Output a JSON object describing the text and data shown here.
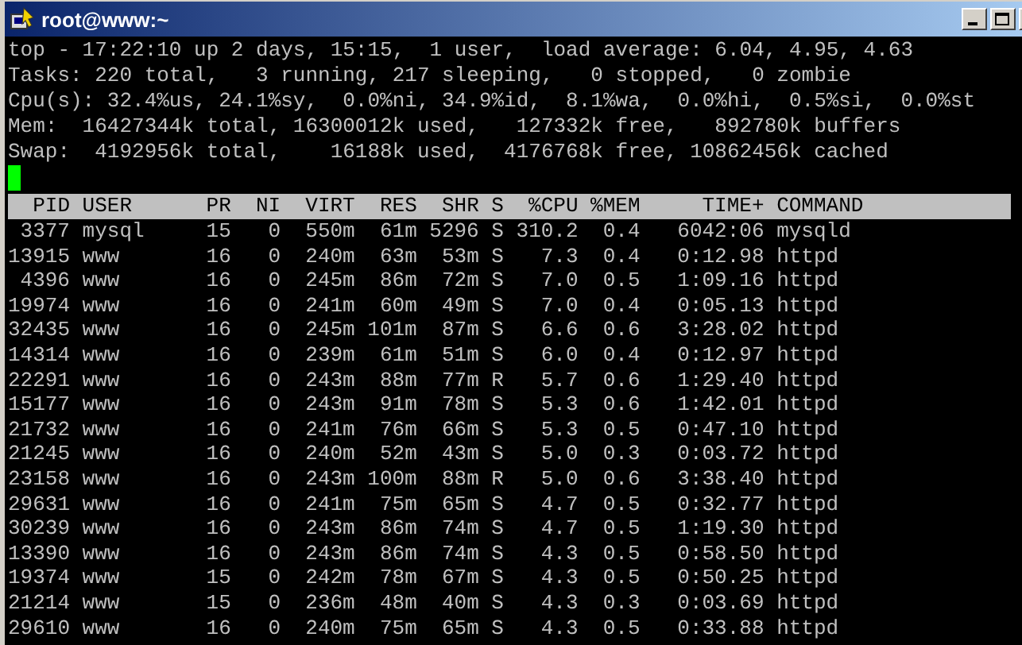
{
  "window": {
    "title": "root@www:~"
  },
  "summary": [
    "top - 17:22:10 up 2 days, 15:15,  1 user,  load average: 6.04, 4.95, 4.63",
    "Tasks: 220 total,   3 running, 217 sleeping,   0 stopped,   0 zombie",
    "Cpu(s): 32.4%us, 24.1%sy,  0.0%ni, 34.9%id,  8.1%wa,  0.0%hi,  0.5%si,  0.0%st",
    "Mem:  16427344k total, 16300012k used,   127332k free,   892780k buffers",
    "Swap:  4192956k total,    16188k used,  4176768k free, 10862456k cached"
  ],
  "table": {
    "columns": [
      "PID",
      "USER",
      "PR",
      "NI",
      "VIRT",
      "RES",
      "SHR",
      "S",
      "%CPU",
      "%MEM",
      "TIME+",
      "COMMAND"
    ],
    "rows": [
      [
        "3377",
        "mysql",
        "15",
        "0",
        "550m",
        "61m",
        "5296",
        "S",
        "310.2",
        "0.4",
        "6042:06",
        "mysqld"
      ],
      [
        "13915",
        "www",
        "16",
        "0",
        "240m",
        "63m",
        "53m",
        "S",
        "7.3",
        "0.4",
        "0:12.98",
        "httpd"
      ],
      [
        "4396",
        "www",
        "16",
        "0",
        "245m",
        "86m",
        "72m",
        "S",
        "7.0",
        "0.5",
        "1:09.16",
        "httpd"
      ],
      [
        "19974",
        "www",
        "16",
        "0",
        "241m",
        "60m",
        "49m",
        "S",
        "7.0",
        "0.4",
        "0:05.13",
        "httpd"
      ],
      [
        "32435",
        "www",
        "16",
        "0",
        "245m",
        "101m",
        "87m",
        "S",
        "6.6",
        "0.6",
        "3:28.02",
        "httpd"
      ],
      [
        "14314",
        "www",
        "16",
        "0",
        "239m",
        "61m",
        "51m",
        "S",
        "6.0",
        "0.4",
        "0:12.97",
        "httpd"
      ],
      [
        "22291",
        "www",
        "16",
        "0",
        "243m",
        "88m",
        "77m",
        "R",
        "5.7",
        "0.6",
        "1:29.40",
        "httpd"
      ],
      [
        "15177",
        "www",
        "16",
        "0",
        "243m",
        "91m",
        "78m",
        "S",
        "5.3",
        "0.6",
        "1:42.01",
        "httpd"
      ],
      [
        "21732",
        "www",
        "16",
        "0",
        "241m",
        "76m",
        "66m",
        "S",
        "5.3",
        "0.5",
        "0:47.10",
        "httpd"
      ],
      [
        "21245",
        "www",
        "16",
        "0",
        "240m",
        "52m",
        "43m",
        "S",
        "5.0",
        "0.3",
        "0:03.72",
        "httpd"
      ],
      [
        "23158",
        "www",
        "16",
        "0",
        "243m",
        "100m",
        "88m",
        "R",
        "5.0",
        "0.6",
        "3:38.40",
        "httpd"
      ],
      [
        "29631",
        "www",
        "16",
        "0",
        "241m",
        "75m",
        "65m",
        "S",
        "4.7",
        "0.5",
        "0:32.77",
        "httpd"
      ],
      [
        "30239",
        "www",
        "16",
        "0",
        "243m",
        "86m",
        "74m",
        "S",
        "4.7",
        "0.5",
        "1:19.30",
        "httpd"
      ],
      [
        "13390",
        "www",
        "16",
        "0",
        "243m",
        "86m",
        "74m",
        "S",
        "4.3",
        "0.5",
        "0:58.50",
        "httpd"
      ],
      [
        "19374",
        "www",
        "15",
        "0",
        "242m",
        "78m",
        "67m",
        "S",
        "4.3",
        "0.5",
        "0:50.25",
        "httpd"
      ],
      [
        "21214",
        "www",
        "15",
        "0",
        "236m",
        "48m",
        "40m",
        "S",
        "4.3",
        "0.3",
        "0:03.69",
        "httpd"
      ],
      [
        "29610",
        "www",
        "16",
        "0",
        "240m",
        "75m",
        "65m",
        "S",
        "4.3",
        "0.5",
        "0:33.88",
        "httpd"
      ]
    ]
  }
}
